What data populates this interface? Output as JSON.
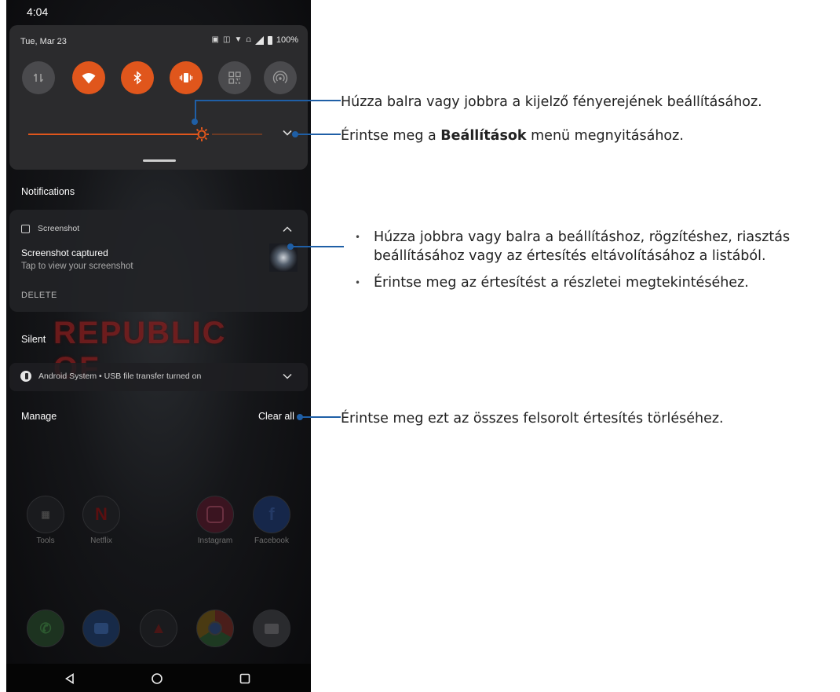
{
  "status_bar": {
    "time": "4:04"
  },
  "quick_settings": {
    "date": "Tue, Mar 23",
    "battery": "100%",
    "tiles": [
      {
        "name": "mobile-data",
        "icon": "data-arrows-icon",
        "state": "off"
      },
      {
        "name": "wifi",
        "icon": "wifi-icon",
        "state": "on"
      },
      {
        "name": "bluetooth",
        "icon": "bluetooth-icon",
        "state": "on"
      },
      {
        "name": "vibrate",
        "icon": "vibrate-icon",
        "state": "on"
      },
      {
        "name": "qr-scanner",
        "icon": "qr-code-icon",
        "state": "off"
      },
      {
        "name": "hotspot",
        "icon": "hotspot-icon",
        "state": "off"
      }
    ],
    "brightness_level": 0.74
  },
  "notifications": {
    "header": "Notifications",
    "screenshot_card": {
      "app_name": "Screenshot",
      "title": "Screenshot captured",
      "text": "Tap to view your screenshot",
      "action": "DELETE"
    },
    "silent_header": "Silent",
    "android_system": "Android System • USB file transfer turned on",
    "manage": "Manage",
    "clear_all": "Clear all"
  },
  "wallpaper_banner": "REPUBLIC OF",
  "home_apps": [
    {
      "label": "Tools"
    },
    {
      "label": "Netflix"
    },
    {
      "label": "Instagram"
    },
    {
      "label": "Facebook"
    }
  ],
  "callouts": {
    "brightness": "Húzza balra vagy jobbra a kijelző fényerejének beállításához.",
    "settings_prefix": "Érintse meg a ",
    "settings_bold": "Beállítások",
    "settings_suffix": " menü megnyitásához.",
    "notification_swipe": "Húzza jobbra vagy balra a beállításhoz, rögzítéshez, riasztás beállításához vagy az értesítés eltávolításához a listából.",
    "notification_tap": "Érintse meg az értesítést a részletei megtekintéséhez.",
    "clear_all": "Érintse meg ezt az összes felsorolt értesítés törléséhez."
  },
  "colors": {
    "accent": "#e0561c",
    "callout_line": "#1f5fa6"
  }
}
